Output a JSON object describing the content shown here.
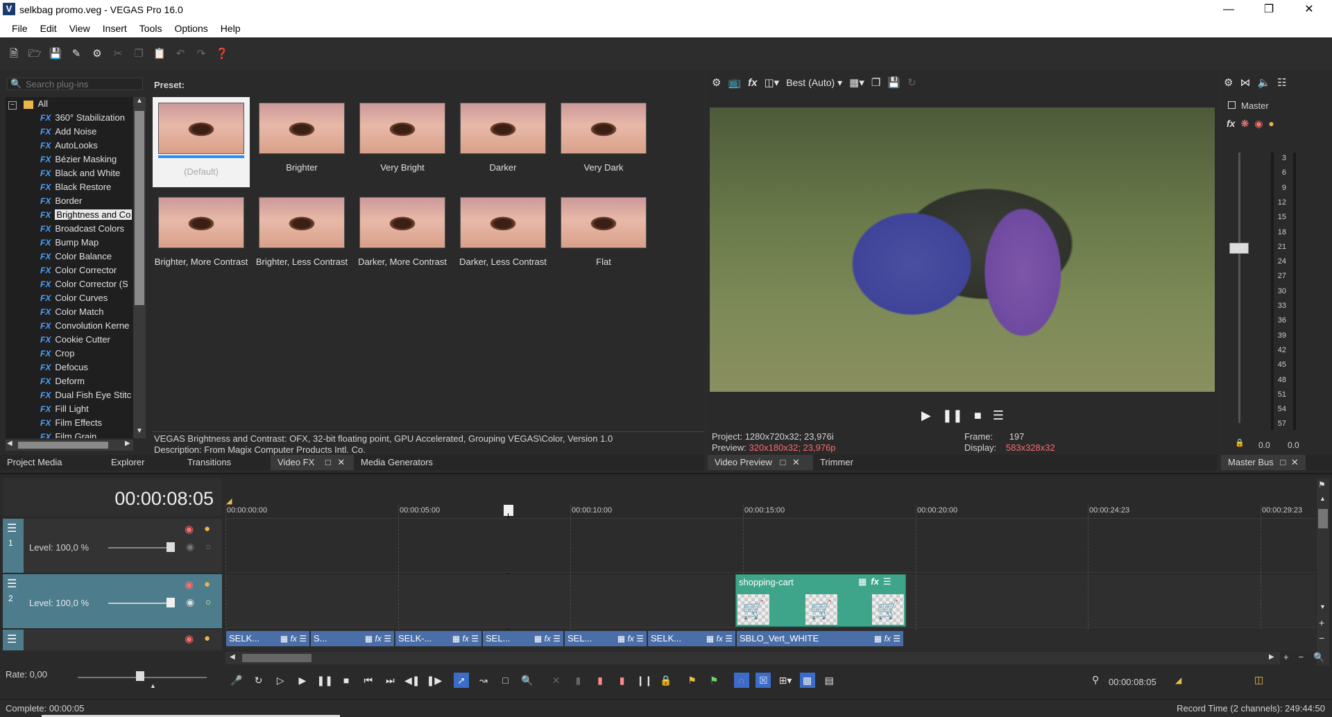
{
  "window": {
    "title": "selkbag promo.veg - VEGAS Pro 16.0",
    "app_icon": "V"
  },
  "menu": [
    "File",
    "Edit",
    "View",
    "Insert",
    "Tools",
    "Options",
    "Help"
  ],
  "plugins": {
    "search_placeholder": "Search plug-ins",
    "root": "All",
    "items": [
      "360° Stabilization",
      "Add Noise",
      "AutoLooks",
      "Bézier Masking",
      "Black and White",
      "Black Restore",
      "Border",
      "Brightness and Co",
      "Broadcast Colors",
      "Bump Map",
      "Color Balance",
      "Color Corrector",
      "Color Corrector (S",
      "Color Curves",
      "Color Match",
      "Convolution Kerne",
      "Cookie Cutter",
      "Crop",
      "Defocus",
      "Deform",
      "Dual Fish Eye Stitc",
      "Fill Light",
      "Film Effects",
      "Film Grain"
    ],
    "selected_index": 7
  },
  "presets": {
    "label": "Preset:",
    "items": [
      "(Default)",
      "Brighter",
      "Very Bright",
      "Darker",
      "Very Dark",
      "Brighter, More Contrast",
      "Brighter, Less Contrast",
      "Darker, More Contrast",
      "Darker, Less Contrast",
      "Flat"
    ],
    "selected_index": 0
  },
  "plugin_info": {
    "line1": "VEGAS Brightness and Contrast: OFX, 32-bit floating point, GPU Accelerated, Grouping VEGAS\\Color, Version 1.0",
    "line2": "Description: From Magix Computer Products Intl. Co."
  },
  "left_tabs": [
    "Project Media",
    "Explorer",
    "Transitions",
    "Video FX",
    "Media Generators"
  ],
  "preview": {
    "quality": "Best (Auto)",
    "project_label": "Project:",
    "project_value": "1280x720x32; 23,976i",
    "preview_label": "Preview:",
    "preview_value": "320x180x32; 23,976p",
    "frame_label": "Frame:",
    "frame_value": "197",
    "display_label": "Display:",
    "display_value": "583x328x32",
    "tabs": [
      "Video Preview",
      "Trimmer"
    ],
    "red_color": "#ff6b6b"
  },
  "master": {
    "label": "Master",
    "ticks": [
      "3",
      "6",
      "9",
      "12",
      "15",
      "18",
      "21",
      "24",
      "27",
      "30",
      "33",
      "36",
      "39",
      "42",
      "45",
      "48",
      "51",
      "54",
      "57"
    ],
    "left_value": "0.0",
    "right_value": "0.0",
    "tab": "Master Bus"
  },
  "timeline": {
    "timecode": "00:00:08:05",
    "ruler": [
      "00:00:00:00",
      "00:00:05:00",
      "00:00:10:00",
      "00:00:15:00",
      "00:00:20:00",
      "00:00:24:23",
      "00:00:29:23"
    ],
    "track1": {
      "num": "1",
      "level": "Level: 100,0 %"
    },
    "track2": {
      "num": "2",
      "level": "Level: 100,0 %"
    },
    "clip_cart": "shopping-cart",
    "audio_clips": [
      "SELK...",
      "S...",
      "SELK-...",
      "SEL...",
      "SEL...",
      "SELK...",
      "SBLO_Vert_WHITE"
    ],
    "rate": "Rate: 0,00",
    "cursor_time": "00:00:08:05",
    "track_color": "#4d7d8c",
    "clip_color": "#3fa58a"
  },
  "status": {
    "left": "Complete: 00:00:05",
    "right": "Record Time (2 channels): 249:44:50"
  }
}
